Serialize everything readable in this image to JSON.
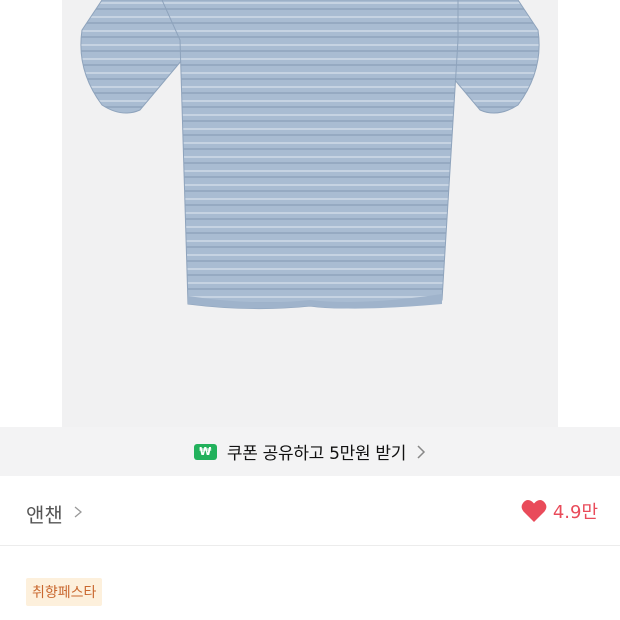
{
  "product": {
    "image_alt": "",
    "colors": {
      "shirt": "#a5b8cf",
      "shirt_dark": "#8ea3bc",
      "background": "#f1f1f2"
    }
  },
  "coupon_banner": {
    "icon_glyph": "₩",
    "icon_name": "won-icon",
    "text": "쿠폰 공유하고 5만원 받기",
    "chevron": "chevron-right-icon"
  },
  "seller": {
    "name": "앤챈",
    "likes": "4.9만",
    "like_color": "#e94b5a"
  },
  "tag": {
    "label": "취향페스타"
  }
}
